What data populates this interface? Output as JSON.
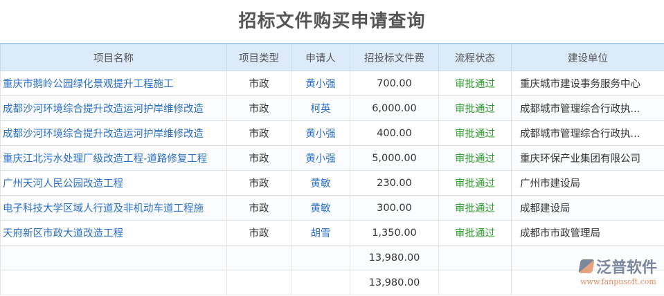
{
  "title": "招标文件购买申请查询",
  "headers": [
    "项目名称",
    "项目类型",
    "申请人",
    "招投标文件费",
    "流程状态",
    "建设单位"
  ],
  "rows": [
    [
      "重庆市鹅岭公园绿化景观提升工程施工",
      "市政",
      "黄小强",
      "700.00",
      "审批通过",
      "重庆城市建设事务服务中心"
    ],
    [
      "成都沙河环境综合提升改造运河护岸维修改造",
      "市政",
      "柯英",
      "6,000.00",
      "审批通过",
      "成都城市管理综合行政执..."
    ],
    [
      "成都沙河环境综合提升改造运河护岸维修改造",
      "市政",
      "黄小强",
      "400.00",
      "审批通过",
      "成都城市管理综合行政执..."
    ],
    [
      "重庆江北污水处理厂级改造工程-道路修复工程",
      "市政",
      "黄小强",
      "5,000.00",
      "审批通过",
      "重庆环保产业集团有限公司"
    ],
    [
      "广州天河人民公园改造工程",
      "市政",
      "黄敏",
      "230.00",
      "审批通过",
      "广州市建设局"
    ],
    [
      "电子科技大学区域人行道及非机动车道工程施",
      "市政",
      "黄敏",
      "300.00",
      "审批通过",
      "成都建设局"
    ],
    [
      "天府新区市政大道改造工程",
      "市政",
      "胡雪",
      "1,350.00",
      "审批通过",
      "成都市市政管理局"
    ]
  ],
  "totals": [
    "13,980.00",
    "13,980.00"
  ],
  "logo": {
    "name": "泛普软件",
    "url": "www.fanpusoft.com"
  }
}
